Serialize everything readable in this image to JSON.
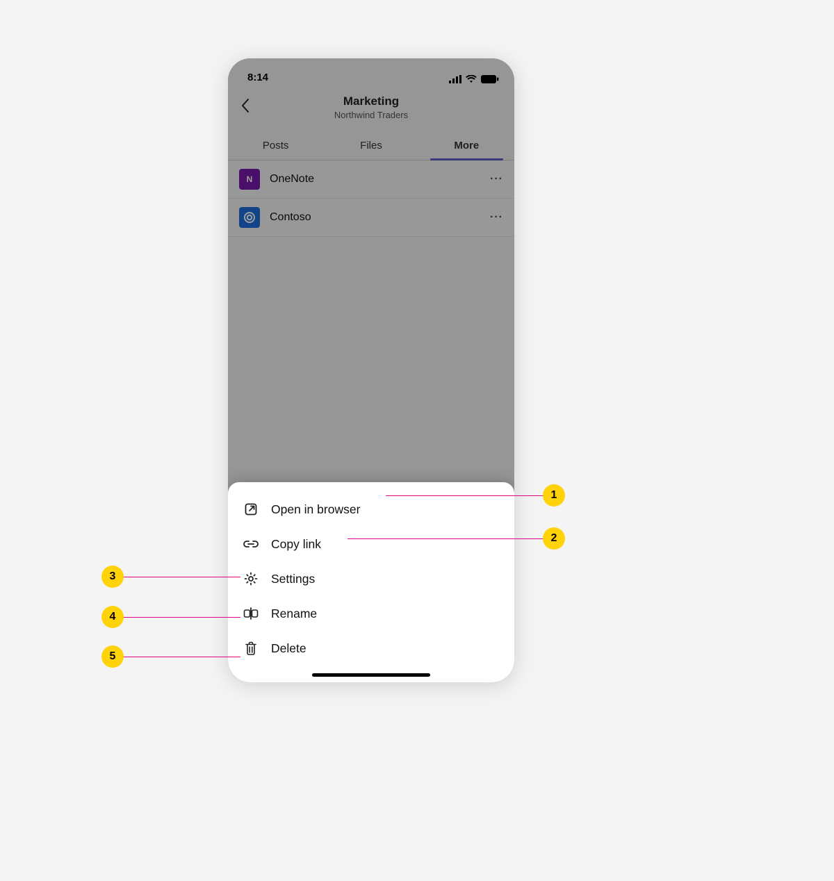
{
  "status": {
    "time": "8:14"
  },
  "header": {
    "title": "Marketing",
    "subtitle": "Northwind Traders"
  },
  "tabs": [
    {
      "label": "Posts",
      "active": false
    },
    {
      "label": "Files",
      "active": false
    },
    {
      "label": "More",
      "active": true
    }
  ],
  "rows": [
    {
      "label": "OneNote",
      "icon": "onenote"
    },
    {
      "label": "Contoso",
      "icon": "contoso"
    }
  ],
  "sheet": [
    {
      "label": "Open in browser",
      "icon": "open-external"
    },
    {
      "label": "Copy link",
      "icon": "link"
    },
    {
      "label": "Settings",
      "icon": "gear"
    },
    {
      "label": "Rename",
      "icon": "rename"
    },
    {
      "label": "Delete",
      "icon": "trash"
    }
  ],
  "callouts": {
    "c1": "1",
    "c2": "2",
    "c3": "3",
    "c4": "4",
    "c5": "5"
  }
}
